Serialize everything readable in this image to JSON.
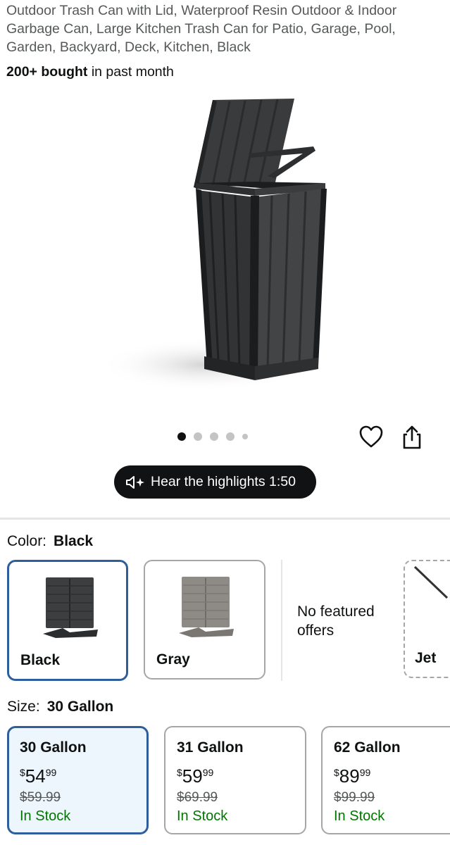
{
  "product": {
    "title": "Outdoor Trash Can with Lid, Waterproof Resin Outdoor & Indoor Garbage Can, Large Kitchen Trash Can for Patio, Garage, Pool, Garden, Backyard, Deck, Kitchen, Black",
    "bought_bold": "200+ bought",
    "bought_rest": " in past month"
  },
  "gallery": {
    "image_count": 5,
    "active_index": 0
  },
  "audio": {
    "label": "Hear the highlights 1:50"
  },
  "color": {
    "label": "Color:",
    "selected": "Black",
    "options": [
      {
        "name": "Black",
        "selected": true
      },
      {
        "name": "Gray",
        "selected": false
      }
    ],
    "no_offers": "No featured offers",
    "partial_option": "Jet"
  },
  "size": {
    "label": "Size:",
    "selected": "30 Gallon",
    "options": [
      {
        "name": "30 Gallon",
        "currency": "$",
        "whole": "54",
        "cents": "99",
        "list_price": "$59.99",
        "stock": "In Stock",
        "selected": true
      },
      {
        "name": "31 Gallon",
        "currency": "$",
        "whole": "59",
        "cents": "99",
        "list_price": "$69.99",
        "stock": "In Stock",
        "selected": false
      },
      {
        "name": "62 Gallon",
        "currency": "$",
        "whole": "89",
        "cents": "99",
        "list_price": "$99.99",
        "stock": "In Stock",
        "selected": false
      }
    ]
  },
  "colors": {
    "selected_border": "#2f5e9c",
    "in_stock": "#007600",
    "selected_bg": "#edf5fd"
  }
}
